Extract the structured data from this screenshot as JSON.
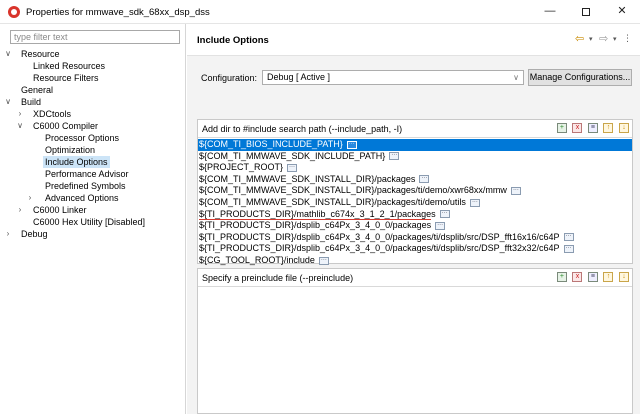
{
  "window": {
    "title": "Properties for mmwave_sdk_68xx_dsp_dss",
    "min_glyph": "—",
    "close_glyph": "✕"
  },
  "filter": {
    "placeholder": "type filter text"
  },
  "tree": [
    {
      "label": "Resource",
      "level": 0,
      "toggle": "∨"
    },
    {
      "label": "Linked Resources",
      "level": 1,
      "toggle": ""
    },
    {
      "label": "Resource Filters",
      "level": 1,
      "toggle": ""
    },
    {
      "label": "General",
      "level": 0,
      "toggle": ""
    },
    {
      "label": "Build",
      "level": 0,
      "toggle": "∨"
    },
    {
      "label": "XDCtools",
      "level": 1,
      "toggle": "›"
    },
    {
      "label": "C6000 Compiler",
      "level": 1,
      "toggle": "∨"
    },
    {
      "label": "Processor Options",
      "level": 2,
      "toggle": ""
    },
    {
      "label": "Optimization",
      "level": 2,
      "toggle": ""
    },
    {
      "label": "Include Options",
      "level": 2,
      "toggle": "",
      "selected": true
    },
    {
      "label": "Performance Advisor",
      "level": 2,
      "toggle": ""
    },
    {
      "label": "Predefined Symbols",
      "level": 2,
      "toggle": ""
    },
    {
      "label": "Advanced Options",
      "level": 2,
      "toggle": "›"
    },
    {
      "label": "C6000 Linker",
      "level": 1,
      "toggle": "›"
    },
    {
      "label": "C6000 Hex Utility  [Disabled]",
      "level": 1,
      "toggle": ""
    },
    {
      "label": "Debug",
      "level": 0,
      "toggle": "›"
    }
  ],
  "page": {
    "title": "Include Options"
  },
  "configuration": {
    "label": "Configuration:",
    "value": "Debug  [ Active ]",
    "manage_label": "Manage Configurations..."
  },
  "include_path": {
    "title": "Add dir to #include search path (--include_path, -I)",
    "items": [
      "${COM_TI_BIOS_INCLUDE_PATH}",
      "${COM_TI_MMWAVE_SDK_INCLUDE_PATH}",
      "${PROJECT_ROOT}",
      "${COM_TI_MMWAVE_SDK_INSTALL_DIR}/packages",
      "${COM_TI_MMWAVE_SDK_INSTALL_DIR}/packages/ti/demo/xwr68xx/mmw",
      "${COM_TI_MMWAVE_SDK_INSTALL_DIR}/packages/ti/demo/utils",
      "${TI_PRODUCTS_DIR}/mathlib_c674x_3_1_2_1/packages",
      "${TI_PRODUCTS_DIR}/dsplib_c64Px_3_4_0_0/packages",
      "${TI_PRODUCTS_DIR}/dsplib_c64Px_3_4_0_0/packages/ti/dsplib/src/DSP_fft16x16/c64P",
      "${TI_PRODUCTS_DIR}/dsplib_c64Px_3_4_0_0/packages/ti/dsplib/src/DSP_fft32x32/c64P",
      "${CG_TOOL_ROOT}/include"
    ]
  },
  "preinclude": {
    "title": "Specify a preinclude file (--preinclude)"
  },
  "icons": {
    "add": "add-icon",
    "delete": "delete-icon",
    "edit": "edit-icon",
    "move_up": "move-up-icon",
    "move_down": "move-down-icon",
    "back": "back-arrow-icon",
    "forward": "forward-arrow-icon"
  },
  "colors": {
    "selection": "#0078d7",
    "tree_selection": "#cce4f7",
    "annotation_line": "#d43a2f"
  }
}
